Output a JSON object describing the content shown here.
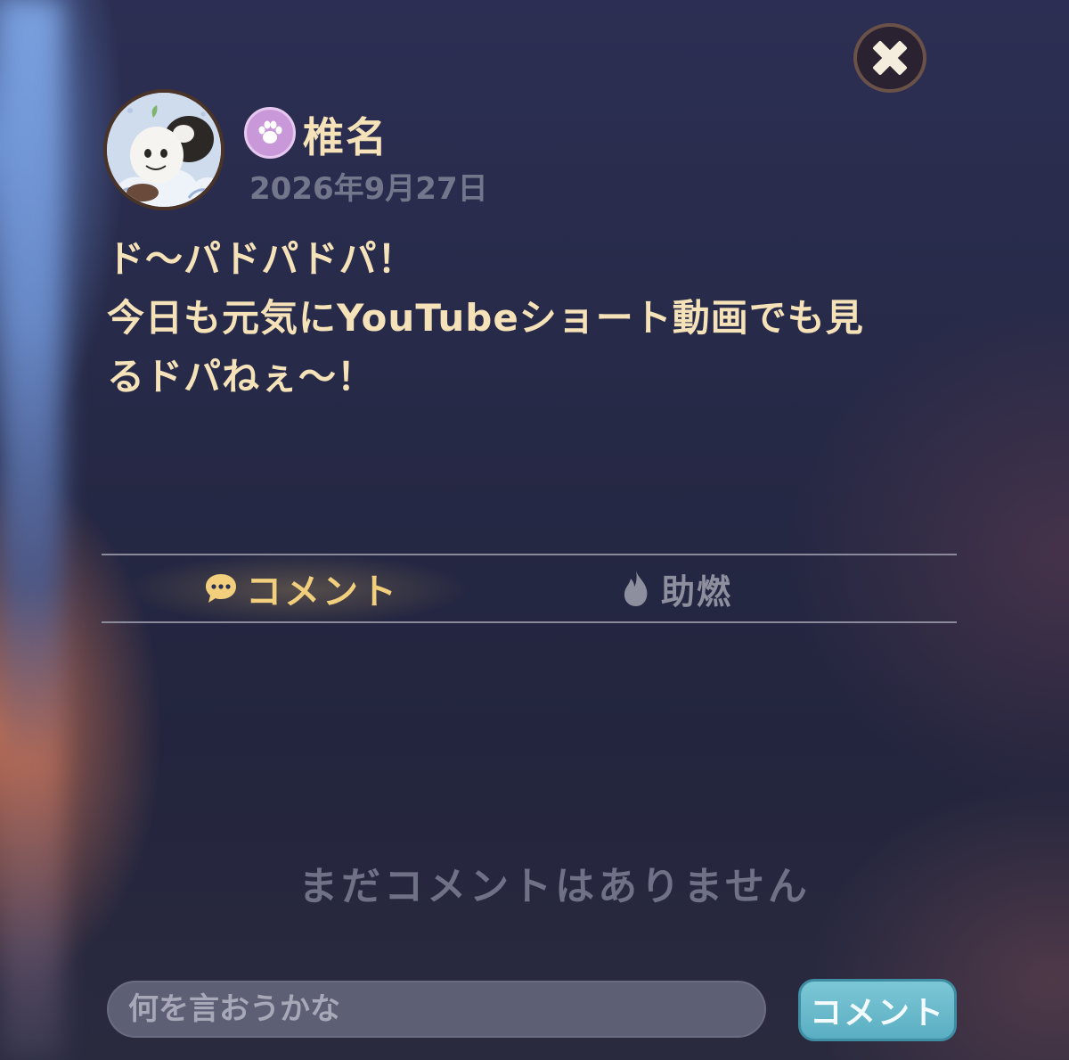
{
  "post": {
    "username": "椎名",
    "date": "2026年9月27日",
    "lines": [
      "ド～パドパドパ！",
      "今日も元気にYouTubeショート動画でも見",
      "るドパねぇ～！"
    ]
  },
  "tabs": {
    "comment_label": "コメント",
    "boost_label": "助燃",
    "active": "comment"
  },
  "comments": {
    "empty_message": "まだコメントはありません"
  },
  "input": {
    "placeholder": "何を言おうかな",
    "value": ""
  },
  "submit": {
    "label": "コメント"
  },
  "icons": {
    "close": "close-icon",
    "badge": "paw-icon",
    "comment_tab": "chat-bubble-icon",
    "boost_tab": "flame-icon"
  },
  "colors": {
    "accent_text": "#f6e2b8",
    "active_tab": "#f2cf7d",
    "muted_text": "#74778c",
    "submit_button": "#6bbccc",
    "badge": "#c998d8"
  }
}
